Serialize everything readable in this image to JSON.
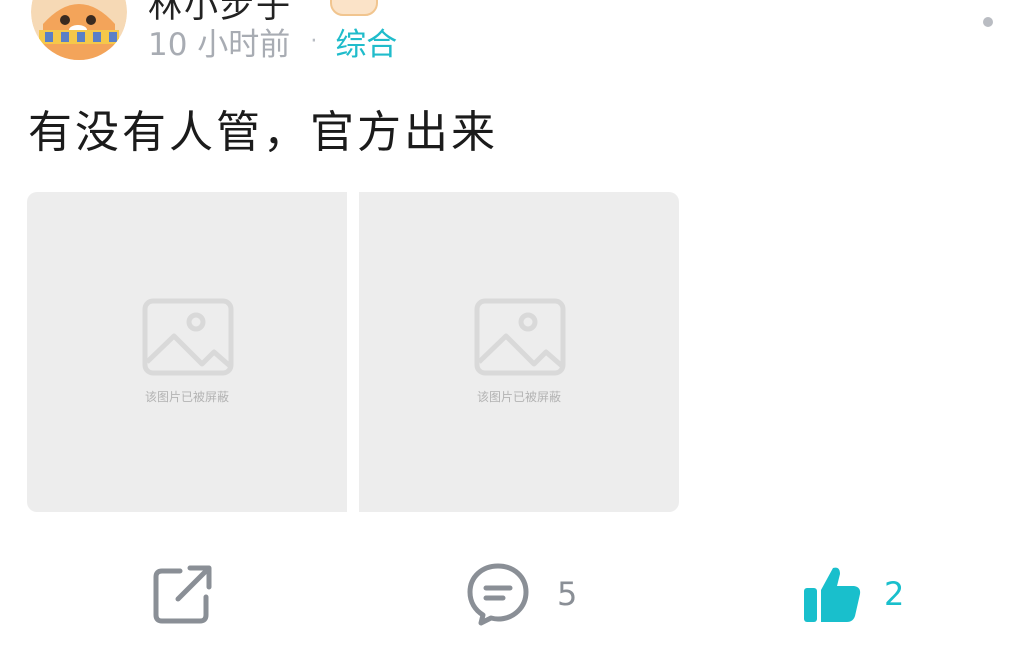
{
  "header": {
    "username": "林小步子",
    "time_ago": "10 小时前",
    "separator": "·",
    "category": "综合"
  },
  "post": {
    "text": "有没有人管，官方出来",
    "images": [
      {
        "placeholder_text": "该图片已被屏蔽"
      },
      {
        "placeholder_text": "该图片已被屏蔽"
      }
    ]
  },
  "actions": {
    "share_icon": "share-external-icon",
    "comment_icon": "comment-bubble-icon",
    "comment_count": "5",
    "like_icon": "thumbs-up-icon",
    "like_count": "2"
  },
  "colors": {
    "accent": "#20bccb",
    "muted_text": "#a8acb3",
    "image_placeholder_bg": "#ededed"
  }
}
